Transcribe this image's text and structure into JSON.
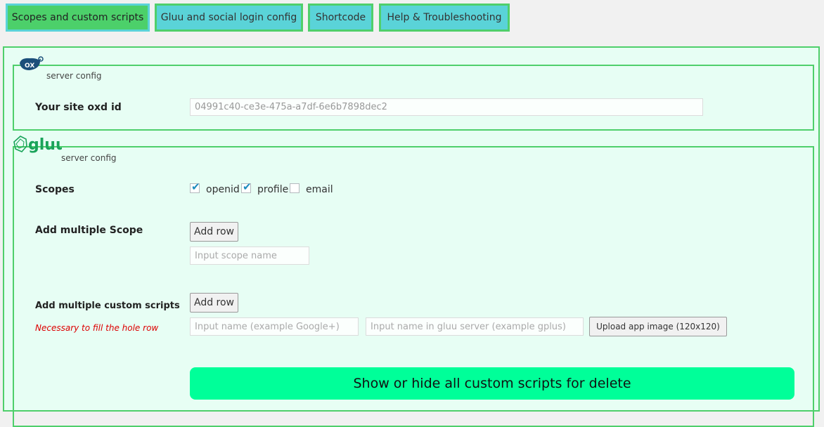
{
  "tabs": [
    {
      "label": "Scopes and custom scripts",
      "active": true
    },
    {
      "label": "Gluu and social login config",
      "active": false
    },
    {
      "label": "Shortcode",
      "active": false
    },
    {
      "label": "Help & Troubleshooting",
      "active": false
    }
  ],
  "oxd_section": {
    "logo_text": "OX",
    "legend": "server config",
    "site_id_label": "Your site oxd id",
    "site_id_value": "04991c40-ce3e-475a-a7df-6e6b7898dec2"
  },
  "gluu_section": {
    "logo_text": "gluu",
    "legend": "server config",
    "scopes_label": "Scopes",
    "scopes": [
      {
        "label": "openid",
        "checked": true
      },
      {
        "label": "profile",
        "checked": true
      },
      {
        "label": "email",
        "checked": false
      }
    ],
    "add_multiple_scope_label": "Add multiple Scope",
    "add_row_label": "Add row",
    "scope_name_placeholder": "Input scope name",
    "add_custom_scripts_label": "Add multiple custom scripts",
    "custom_scripts_note": "Necessary to fill the hole row",
    "add_row_label_2": "Add row",
    "script_name_placeholder": "Input name (example Google+)",
    "script_server_name_placeholder": "Input name in gluu server (example gplus)",
    "upload_button_label": "Upload app image (120x120)",
    "show_hide_button_label": "Show or hide all custom scripts for delete"
  }
}
